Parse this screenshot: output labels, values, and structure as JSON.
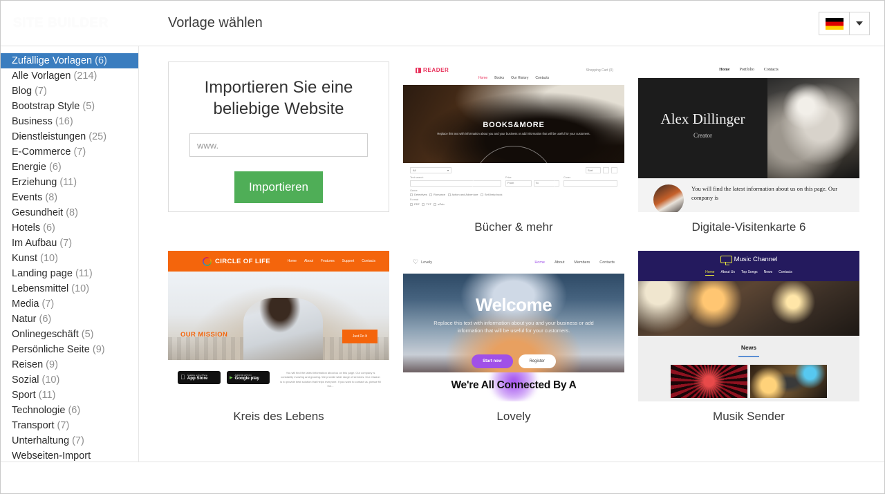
{
  "header": {
    "logo_text": "SITE BUILDER",
    "title": "Vorlage wählen",
    "language": {
      "flag": "de-flag-icon",
      "caret": "chevron-down-icon"
    }
  },
  "sidebar": {
    "items": [
      {
        "label": "Zufällige Vorlagen",
        "count": "(6)",
        "active": true
      },
      {
        "label": "Alle Vorlagen",
        "count": "(214)",
        "active": false
      },
      {
        "label": "Blog",
        "count": "(7)",
        "active": false
      },
      {
        "label": "Bootstrap Style",
        "count": "(5)",
        "active": false
      },
      {
        "label": "Business",
        "count": "(16)",
        "active": false
      },
      {
        "label": "Dienstleistungen",
        "count": "(25)",
        "active": false
      },
      {
        "label": "E-Commerce",
        "count": "(7)",
        "active": false
      },
      {
        "label": "Energie",
        "count": "(6)",
        "active": false
      },
      {
        "label": "Erziehung",
        "count": "(11)",
        "active": false
      },
      {
        "label": "Events",
        "count": "(8)",
        "active": false
      },
      {
        "label": "Gesundheit",
        "count": "(8)",
        "active": false
      },
      {
        "label": "Hotels",
        "count": "(6)",
        "active": false
      },
      {
        "label": "Im Aufbau",
        "count": "(7)",
        "active": false
      },
      {
        "label": "Kunst",
        "count": "(10)",
        "active": false
      },
      {
        "label": "Landing page",
        "count": "(11)",
        "active": false
      },
      {
        "label": "Lebensmittel",
        "count": "(10)",
        "active": false
      },
      {
        "label": "Media",
        "count": "(7)",
        "active": false
      },
      {
        "label": "Natur",
        "count": "(6)",
        "active": false
      },
      {
        "label": "Onlinegeschäft",
        "count": "(5)",
        "active": false
      },
      {
        "label": "Persönliche Seite",
        "count": "(9)",
        "active": false
      },
      {
        "label": "Reisen",
        "count": "(9)",
        "active": false
      },
      {
        "label": "Sozial",
        "count": "(10)",
        "active": false
      },
      {
        "label": "Sport",
        "count": "(11)",
        "active": false
      },
      {
        "label": "Technologie",
        "count": "(6)",
        "active": false
      },
      {
        "label": "Transport",
        "count": "(7)",
        "active": false
      },
      {
        "label": "Unterhaltung",
        "count": "(7)",
        "active": false
      },
      {
        "label": "Webseiten-Import",
        "count": "",
        "active": false
      }
    ]
  },
  "import_card": {
    "title_line1": "Importieren Sie eine",
    "title_line2": "beliebige Website",
    "url_placeholder": "www.",
    "url_value": "",
    "button_label": "Importieren"
  },
  "templates": [
    {
      "id": "buecher-und-mehr",
      "caption": "Bücher & mehr",
      "preview": {
        "brand": "READER",
        "cart": "Shopping Cart (0)",
        "nav": [
          "Home",
          "Books",
          "Our History",
          "Contacts"
        ],
        "hero_title": "BOOKS&MORE",
        "hero_sub": "Replace this text with information about you and your business or add information that will be useful for your customers.",
        "filter_all": "All",
        "filter_sort": "Sort",
        "labels": {
          "text_search": "Text search",
          "price": "Price",
          "cover": "Cover",
          "genre": "Genre",
          "format": "Format"
        },
        "price_from": "From",
        "price_to": "To",
        "genres": [
          "Detectives",
          "Romance",
          "Action and Adventure",
          "Self-help book"
        ],
        "formats": [
          "PDF",
          "TXT",
          "ePub"
        ]
      }
    },
    {
      "id": "digitale-visitenkarte-6",
      "caption": "Digitale-Visitenkarte 6",
      "preview": {
        "nav": [
          "Home",
          "Portfolio",
          "Contacts"
        ],
        "name": "Alex Dillinger",
        "role": "Creator",
        "body_text": "You will find the latest information about us on this page. Our company is"
      }
    },
    {
      "id": "kreis-des-lebens",
      "caption": "Kreis des Lebens",
      "preview": {
        "brand": "CIRCLE OF LIFE",
        "nav": [
          "Home",
          "About",
          "Features",
          "Support",
          "Contacts"
        ],
        "heading": "OUR MISSION",
        "cta": "Just Do It",
        "appstore_small": "Available on the iPhone",
        "appstore_large": "App Store",
        "googleplay_small": "ANDROID APP ON",
        "googleplay_large": "Google play",
        "paragraph": "You will find the latest information about us on this page. Our company is constantly evolving and growing. We provide wide range of services. Our mission is to provide best solution that helps everyone. If you want to contact us, please fill the..."
      }
    },
    {
      "id": "lovely",
      "caption": "Lovely",
      "preview": {
        "brand": "Lovely",
        "nav": [
          "Home",
          "About",
          "Members",
          "Contacts"
        ],
        "hero_title": "Welcome",
        "hero_sub": "Replace this text with information about you and your business or add information that will be useful for your customers.",
        "btn_primary": "Start now",
        "btn_secondary": "Register",
        "section_heading": "We're All Connected By A"
      }
    },
    {
      "id": "musik-sender",
      "caption": "Musik Sender",
      "preview": {
        "brand": "Music Channel",
        "nav": [
          "Home",
          "About Us",
          "Top Songs",
          "News",
          "Contacts"
        ],
        "section_heading": "News"
      }
    }
  ]
}
